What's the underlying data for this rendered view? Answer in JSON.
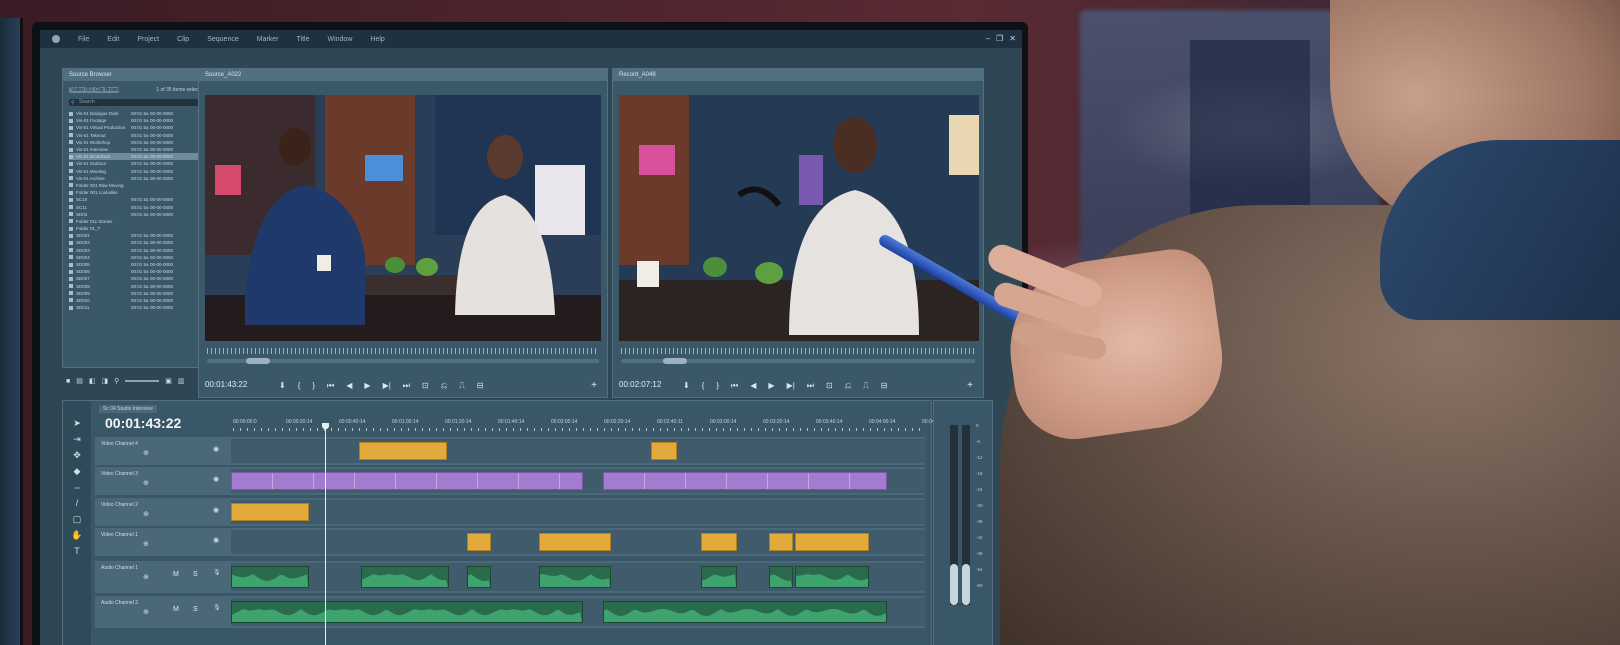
{
  "menu": {
    "items": [
      "File",
      "Edit",
      "Project",
      "Clip",
      "Sequence",
      "Marker",
      "Title",
      "Window",
      "Help"
    ],
    "window_buttons": [
      "–",
      "❐",
      "✕"
    ]
  },
  "browser": {
    "title": "Source Browser",
    "filter_label": "Video 001 Clip Browsing",
    "count_label": "1 of 35 items selected",
    "search_placeholder": "Search",
    "files": [
      {
        "name": "Vis-01 Dialogue Dark",
        "dur": "00:01 5a",
        "date": "00-00-0000"
      },
      {
        "name": "Vis-01 Footage",
        "dur": "00:01 5a",
        "date": "00-00-0000"
      },
      {
        "name": "Vis-01 Virtual Production",
        "dur": "00:01 5a",
        "date": "00-00-0000"
      },
      {
        "name": "Vis-01 Takeout",
        "dur": "00:01 5a",
        "date": "00-00-0000"
      },
      {
        "name": "Vis-01 Workshop",
        "dur": "00:01 5a",
        "date": "00-00-0000"
      },
      {
        "name": "Vis-01 Interview",
        "dur": "00:01 5a",
        "date": "00-00-0000"
      },
      {
        "name": "Vis-01 Broadcast",
        "dur": "00:01 5a",
        "date": "00-00-0000"
      },
      {
        "name": "Vis-01 Outdoor",
        "dur": "00:01 5a",
        "date": "00-00-0000"
      },
      {
        "name": "Vis-01 Meeting",
        "dur": "00:01 5a",
        "date": "00-00-0000"
      },
      {
        "name": "Vis-01 Archive",
        "dur": "00:01 5a",
        "date": "00-00-0000"
      },
      {
        "name": "Folder 001 Raw Moving",
        "dur": "",
        "date": ""
      },
      {
        "name": "Folder 001 Lookalike",
        "dur": "",
        "date": ""
      },
      {
        "name": "SC10",
        "dur": "00:01 5a",
        "date": "00-00-0000"
      },
      {
        "name": "SC11",
        "dur": "00:01 5a",
        "date": "00-00-0000"
      },
      {
        "name": "SD03",
        "dur": "00:01 5a",
        "date": "00-00-0000"
      },
      {
        "name": "Folder 011 Stories",
        "dur": "",
        "date": ""
      },
      {
        "name": "Folder 01_T",
        "dur": "",
        "date": ""
      },
      {
        "name": "SD001",
        "dur": "00:01 5a",
        "date": "00-00-0000"
      },
      {
        "name": "SD002",
        "dur": "00:01 5a",
        "date": "00-00-0000"
      },
      {
        "name": "SD003",
        "dur": "00:01 5a",
        "date": "00-00-0000"
      },
      {
        "name": "SD004",
        "dur": "00:01 5a",
        "date": "00-00-0000"
      },
      {
        "name": "SD005",
        "dur": "00:01 5a",
        "date": "00-00-0000"
      },
      {
        "name": "SD006",
        "dur": "00:01 5a",
        "date": "00-00-0000"
      },
      {
        "name": "SD007",
        "dur": "00:01 5a",
        "date": "00-00-0000"
      },
      {
        "name": "SD008",
        "dur": "00:01 5a",
        "date": "00-00-0000"
      },
      {
        "name": "SD009",
        "dur": "00:01 5a",
        "date": "00-00-0000"
      },
      {
        "name": "SD010",
        "dur": "00:01 5a",
        "date": "00-00-0000"
      },
      {
        "name": "SD011",
        "dur": "00:01 5a",
        "date": "00-00-0000"
      }
    ],
    "selected_index": 6,
    "footer_icons": [
      "■",
      "▤",
      "◧",
      "◨",
      "⚲",
      "▣",
      "▥"
    ]
  },
  "source_monitor": {
    "title": "Source_A022",
    "timecode": "00:01:43:22",
    "playhead_fraction": 0.1,
    "controls": [
      "⬇",
      "{",
      "}",
      "⏮",
      "◀",
      "▶",
      "▶|",
      "⏭",
      "⊡",
      "⎌",
      "⎍",
      "⊟"
    ],
    "add": "+"
  },
  "record_monitor": {
    "title": "Record_A048",
    "timecode": "00:02:07:12",
    "playhead_fraction": 0.12,
    "controls": [
      "⬇",
      "{",
      "}",
      "⏮",
      "◀",
      "▶",
      "▶|",
      "⏭",
      "⊡",
      "⎌",
      "⎍",
      "⊟"
    ],
    "add": "+"
  },
  "timeline": {
    "tab": "Sc 04 Studio Interview",
    "timecode": "00:01:43:22",
    "ticks": [
      "00:00:00:0",
      "00:00:20:14",
      "00:00:40:14",
      "00:01:00:14",
      "00:01:20:14",
      "00:01:40:14",
      "00:02:00:14",
      "00:02:20:14",
      "00:02:40:11",
      "00:03:00:14",
      "00:03:20:14",
      "00:03:40:14",
      "00:04:00:14",
      "00:04:2"
    ],
    "tools": [
      "➤",
      "⇥",
      "✥",
      "◆",
      "⇔",
      "/",
      "▢",
      "✋",
      "T"
    ],
    "tracks": [
      {
        "name": "Video Channel 4",
        "btn": "⊕",
        "eye": "◉"
      },
      {
        "name": "Video Channel 3",
        "btn": "⊕",
        "eye": "◉"
      },
      {
        "name": "Video Channel 2",
        "btn": "⊕",
        "eye": "◉"
      },
      {
        "name": "Video Channel 1",
        "btn": "⊕",
        "eye": "◉"
      },
      {
        "name": "Audio Channel 1",
        "btn": "⊕",
        "m": "M",
        "s": "S",
        "mic": "🎙"
      },
      {
        "name": "Audio Channel 2",
        "btn": "⊕",
        "m": "M",
        "s": "S",
        "mic": "🎙"
      }
    ]
  },
  "meters": {
    "scale": [
      "0",
      "-6",
      "-12",
      "-18",
      "-24",
      "-30",
      "-36",
      "-42",
      "-48",
      "-54",
      "-60"
    ],
    "levels": [
      0.23,
      0.23
    ]
  },
  "colors": {
    "video_clip_yellow": "#e2a93b",
    "video_clip_purple": "#a47bd0",
    "audio_clip_green": "#2a6b4c",
    "panel": "#3b5869"
  }
}
